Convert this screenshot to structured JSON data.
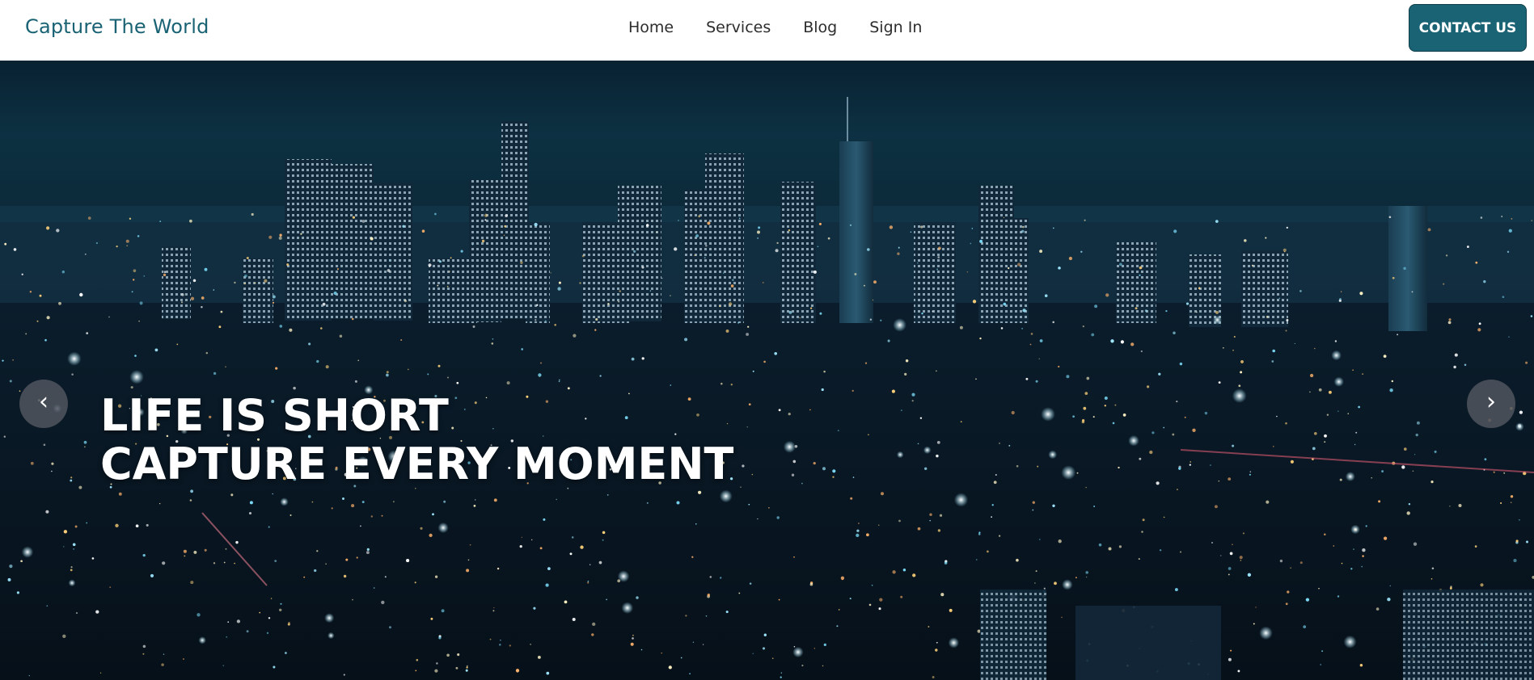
{
  "header": {
    "brand": "Capture The World",
    "nav": [
      "Home",
      "Services",
      "Blog",
      "Sign In"
    ],
    "contact_label": "CONTACT US"
  },
  "hero": {
    "line1": "LIFE IS SHORT",
    "line2": "CAPTURE EVERY MOMENT",
    "prev_label": "‹",
    "next_label": "›",
    "background_image": "night city skyline"
  },
  "colors": {
    "brand": "#1a6374",
    "nav_text": "#2d2d2d",
    "hero_text": "#ffffff"
  }
}
